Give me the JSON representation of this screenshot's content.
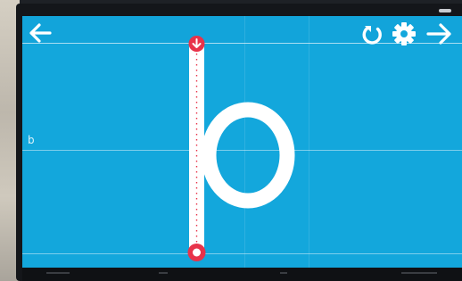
{
  "toolbar": {
    "back": "back-arrow-icon",
    "replay": "replay-icon",
    "settings": "gear-icon",
    "next": "forward-arrow-icon"
  },
  "guide": {
    "label": "b"
  },
  "tracing": {
    "letter": "b",
    "start_marker": "down-arrow-start-icon",
    "end_marker": "end-circle-icon"
  },
  "colors": {
    "screen_background": "#13a7dc",
    "guide_lines": "#ffffff",
    "letter_stroke": "#ffffff",
    "marker_red": "#e8334a",
    "icon_white": "#ffffff"
  }
}
